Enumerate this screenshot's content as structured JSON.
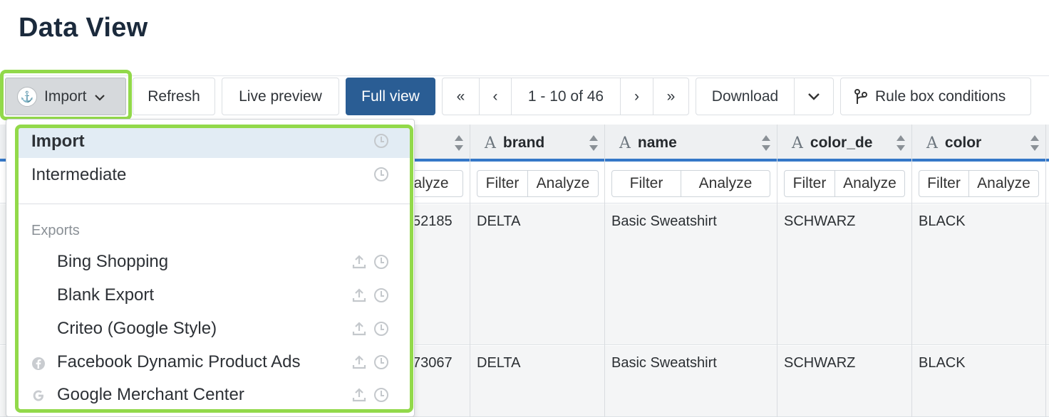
{
  "page": {
    "title": "Data View"
  },
  "toolbar": {
    "import_label": "Import",
    "refresh_label": "Refresh",
    "live_preview_label": "Live preview",
    "full_view_label": "Full view",
    "pager": {
      "first": "«",
      "prev": "‹",
      "range": "1 - 10 of 46",
      "next": "›",
      "last": "»"
    },
    "download_label": "Download",
    "rule_box_label": "Rule box conditions"
  },
  "table": {
    "columns": [
      {
        "type_icon": "A",
        "name": "brand"
      },
      {
        "type_icon": "A",
        "name": "name"
      },
      {
        "type_icon": "A",
        "name": "color_de"
      },
      {
        "type_icon": "A",
        "name": "color"
      }
    ],
    "filter_label": "Filter",
    "analyze_label": "Analyze",
    "partial_analyze_label": "alyze",
    "rows": [
      {
        "id_partial": "52185",
        "brand": "DELTA",
        "name": "Basic Sweatshirt",
        "color_de": "SCHWARZ",
        "color": "BLACK"
      },
      {
        "id_partial": "73067",
        "brand": "DELTA",
        "name": "Basic Sweatshirt",
        "color_de": "SCHWARZ",
        "color": "BLACK"
      }
    ]
  },
  "dropdown": {
    "items": [
      {
        "label": "Import",
        "active": true
      },
      {
        "label": "Intermediate"
      }
    ],
    "exports_header": "Exports",
    "exports": [
      {
        "label": "Bing Shopping",
        "icon": "none"
      },
      {
        "label": "Blank Export",
        "icon": "none"
      },
      {
        "label": "Criteo (Google Style)",
        "icon": "none"
      },
      {
        "label": "Facebook Dynamic Product Ads",
        "icon": "facebook-icon"
      },
      {
        "label": "Google Merchant Center",
        "icon": "google-icon"
      }
    ]
  },
  "colors": {
    "highlight": "#92d94a",
    "primary": "#2a5d94",
    "header_border": "#3578c8"
  }
}
